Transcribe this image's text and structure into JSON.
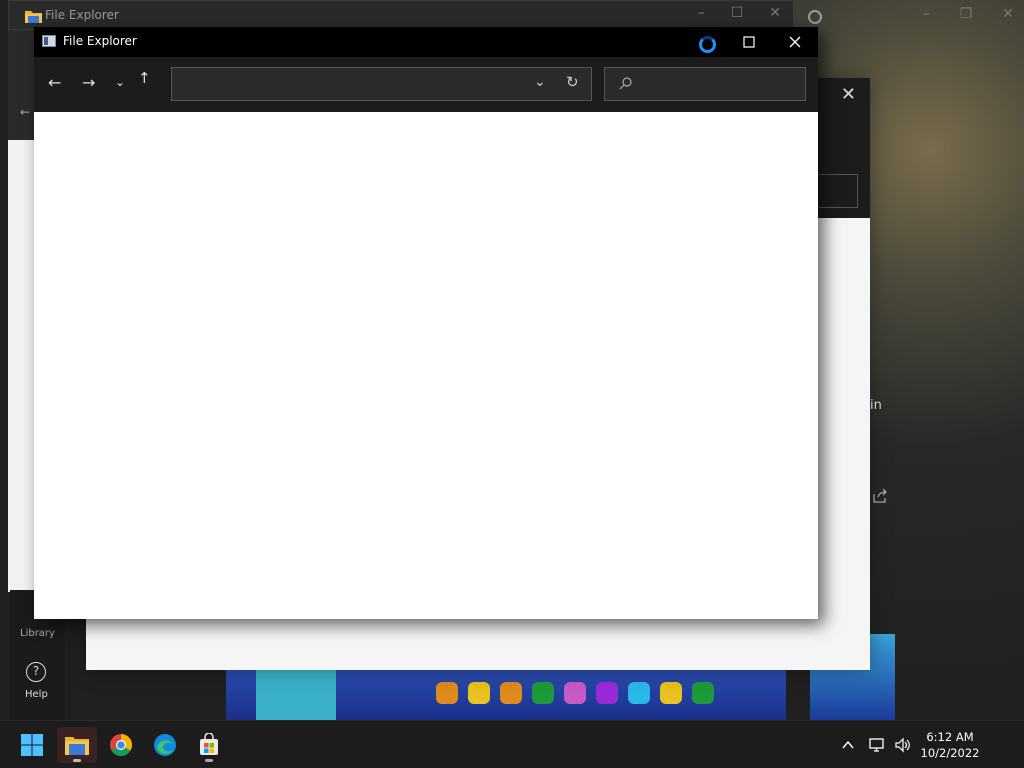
{
  "background": {
    "window_title": "File Explorer",
    "library_label": "Library",
    "help_label": "Help",
    "help_symbol": "?",
    "partial_text": "in"
  },
  "explorer": {
    "title": "File Explorer",
    "address_value": "",
    "search_placeholder": "",
    "nav_back": "←",
    "nav_forward": "→",
    "nav_recent": "⌄",
    "nav_up": "↑",
    "minimize_label": "",
    "maximize_label": "☐",
    "close_label": "✕"
  },
  "taskbar": {
    "apps": [
      {
        "name": "start",
        "icon": "windows-logo-icon"
      },
      {
        "name": "file-explorer",
        "icon": "folder-icon",
        "active": true
      },
      {
        "name": "chrome",
        "icon": "chrome-icon"
      },
      {
        "name": "edge",
        "icon": "edge-icon"
      },
      {
        "name": "store",
        "icon": "store-icon"
      }
    ],
    "time": "6:12 AM",
    "date": "10/2/2022"
  },
  "colors": {
    "accent": "#1e90ff",
    "taskbar": "#1c1c1c",
    "titlebar": "#000000"
  }
}
